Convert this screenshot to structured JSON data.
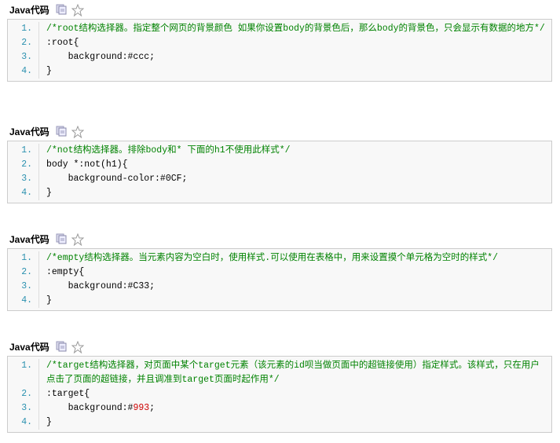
{
  "header_label": "Java代码",
  "blocks": [
    {
      "lines": [
        {
          "n": "1.",
          "cls": "cm",
          "text": "/*root结构选择器。指定整个网页的背景颜色 如果你设置body的背景色后，那么body的背景色，只会显示有数据的地方*/"
        },
        {
          "n": "2.",
          "text": ":root{"
        },
        {
          "n": "3.",
          "text": "    background:#ccc;"
        },
        {
          "n": "4.",
          "text": "}"
        }
      ]
    },
    {
      "lines": [
        {
          "n": "1.",
          "cls": "cm",
          "text": "/*not结构选择器。排除body和* 下面的h1不使用此样式*/"
        },
        {
          "n": "2.",
          "text": "body *:not(h1){"
        },
        {
          "n": "3.",
          "text": "    background-color:#0CF;"
        },
        {
          "n": "4.",
          "text": "}"
        }
      ]
    },
    {
      "lines": [
        {
          "n": "1.",
          "cls": "cm",
          "text": "/*empty结构选择器。当元素内容为空白时，使用样式.可以使用在表格中，用来设置摸个单元格为空时的样式*/"
        },
        {
          "n": "2.",
          "text": ":empty{"
        },
        {
          "n": "3.",
          "text": "    background:#C33;"
        },
        {
          "n": "4.",
          "text": "}"
        }
      ]
    },
    {
      "lines": [
        {
          "n": "1.",
          "cls": "cm",
          "text": "/*target结构选择器，对页面中某个target元素（该元素的id呗当做页面中的超链接使用）指定样式。该样式，只在用户点击了页面的超链接，并且调准到target页面时起作用*/"
        },
        {
          "n": "2.",
          "text": ":target{"
        },
        {
          "n": "3.",
          "text": "    background:#",
          "num": "993",
          "after": ";"
        },
        {
          "n": "4.",
          "text": "}"
        }
      ]
    }
  ]
}
